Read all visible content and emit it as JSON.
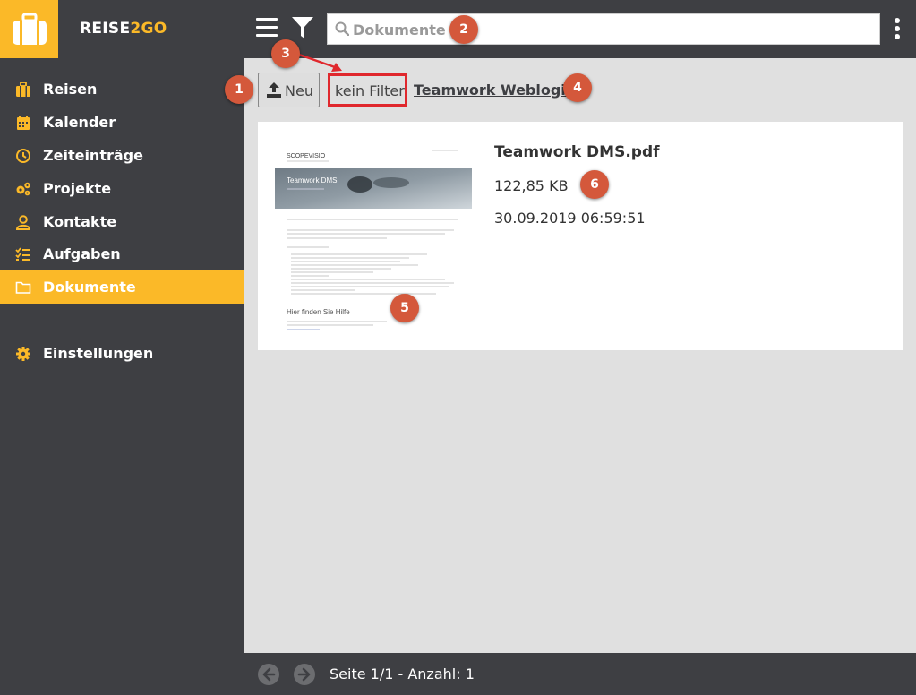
{
  "app": {
    "brand_main": "REISE",
    "brand_accent": "2GO"
  },
  "colors": {
    "accent": "#fbb928",
    "dark": "#3e3f43",
    "annotation": "#d4583b",
    "highlight_box": "#e0282d"
  },
  "header": {
    "menu_icon": "hamburger-icon",
    "filter_icon": "funnel-icon",
    "search": {
      "placeholder": "Dokumente",
      "value": ""
    },
    "more_icon": "kebab-icon"
  },
  "sidebar": {
    "items": [
      {
        "label": "Reisen",
        "icon": "suitcase-icon",
        "active": false
      },
      {
        "label": "Kalender",
        "icon": "calendar-icon",
        "active": false
      },
      {
        "label": "Zeiteinträge",
        "icon": "clock-icon",
        "active": false
      },
      {
        "label": "Projekte",
        "icon": "gears-icon",
        "active": false
      },
      {
        "label": "Kontakte",
        "icon": "user-icon",
        "active": false
      },
      {
        "label": "Aufgaben",
        "icon": "checklist-icon",
        "active": false
      },
      {
        "label": "Dokumente",
        "icon": "folder-icon",
        "active": true
      },
      {
        "label": "Einstellungen",
        "icon": "gear-icon",
        "active": false
      }
    ]
  },
  "toolbar": {
    "new_label": "Neu",
    "filter_label": "kein Filter",
    "weblogin_label": "Teamwork Weblogin"
  },
  "documents": [
    {
      "name": "Teamwork DMS.pdf",
      "size": "122,85 KB",
      "date": "30.09.2019 06:59:51",
      "thumbnail": {
        "logo": "SCOPEVISIO",
        "title": "Teamwork DMS",
        "help_heading": "Hier finden Sie Hilfe"
      }
    }
  ],
  "footer": {
    "prev_icon": "arrow-left-icon",
    "next_icon": "arrow-right-icon",
    "page_info": "Seite 1/1 - Anzahl: 1"
  },
  "annotations": [
    "1",
    "2",
    "3",
    "4",
    "5",
    "6"
  ]
}
